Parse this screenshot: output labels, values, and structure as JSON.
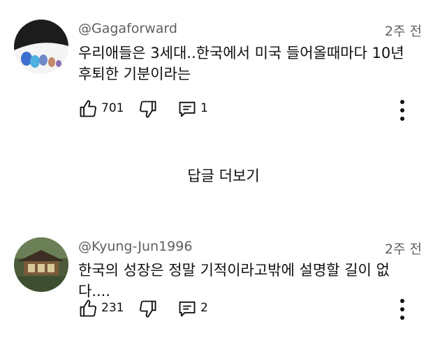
{
  "comments": [
    {
      "handle": "@Gagaforward",
      "time": "2주 전",
      "text": "우리애들은 3세대..한국에서 미국 들어올때마다 10년 후퇴한 기분이라는",
      "likes": "701",
      "replies": "1",
      "avatar_icon": "figurines-avatar-icon"
    },
    {
      "handle": "@Kyung-Jun1996",
      "time": "2주 전",
      "text": "한국의 성장은 정말 기적이라고밖에 설명할 길이 없다....",
      "likes": "231",
      "replies": "2",
      "avatar_icon": "hanok-house-avatar-icon"
    }
  ],
  "more_replies_label": "답글 더보기"
}
